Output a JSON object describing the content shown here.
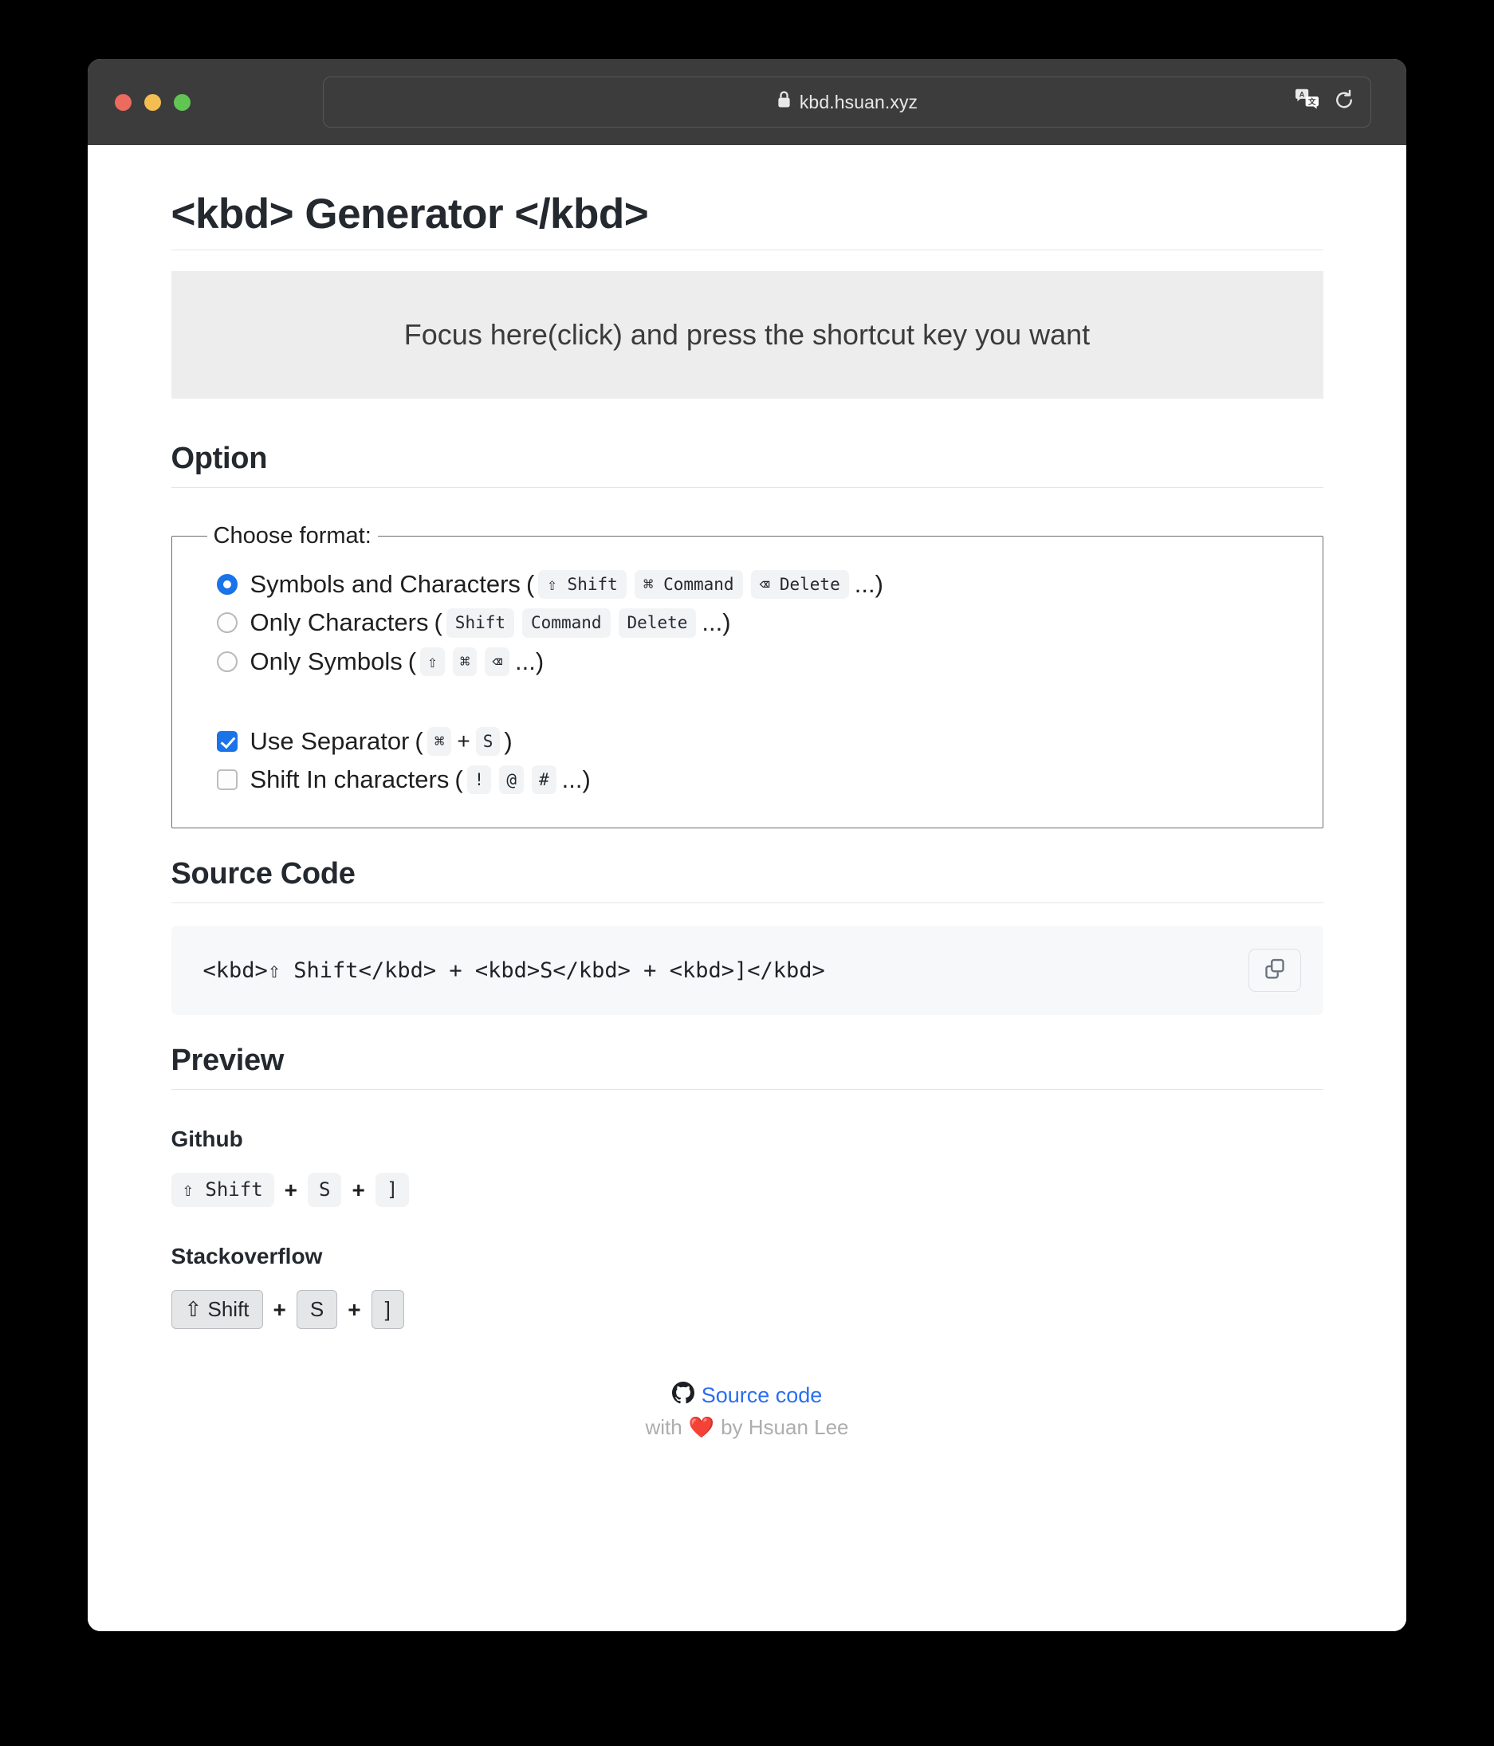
{
  "browser": {
    "url": "kbd.hsuan.xyz",
    "lock_icon": "lock-icon",
    "translate_icon": "translate-icon",
    "reload_icon": "reload-icon",
    "traffic_lights": [
      "close-red",
      "minimize-yellow",
      "maximize-green"
    ]
  },
  "page": {
    "title": "<kbd> Generator </kbd>",
    "focus_area_text": "Focus here(click) and press the shortcut key you want",
    "sections": {
      "option": "Option",
      "source_code": "Source Code",
      "preview": "Preview"
    }
  },
  "option": {
    "legend": "Choose format:",
    "radios": [
      {
        "label": "Symbols and Characters",
        "checked": true,
        "examples": [
          "⇧ Shift",
          "⌘ Command",
          "⌫ Delete"
        ],
        "ellipsis": "..."
      },
      {
        "label": "Only Characters",
        "checked": false,
        "examples": [
          "Shift",
          "Command",
          "Delete"
        ],
        "ellipsis": "..."
      },
      {
        "label": "Only Symbols",
        "checked": false,
        "examples": [
          "⇧",
          "⌘",
          "⌫"
        ],
        "ellipsis": "..."
      }
    ],
    "checkboxes": [
      {
        "label": "Use Separator",
        "checked": true,
        "examples": [
          "⌘",
          "S"
        ],
        "separator": "+",
        "ellipsis": ""
      },
      {
        "label": "Shift In characters",
        "checked": false,
        "examples": [
          "!",
          "@",
          "#"
        ],
        "ellipsis": "..."
      }
    ],
    "open_paren": "(",
    "close_paren": ")"
  },
  "source_code": {
    "code": "<kbd>⇧ Shift</kbd> + <kbd>S</kbd> + <kbd>]</kbd>",
    "copy_button_label": "copy-icon"
  },
  "preview": [
    {
      "title": "Github",
      "style": "github",
      "keys": [
        "⇧ Shift",
        "S",
        "]"
      ],
      "separator": "+"
    },
    {
      "title": "Stackoverflow",
      "style": "stackoverflow",
      "keys": [
        "⇧ Shift",
        "S",
        "]"
      ],
      "separator": "+"
    }
  ],
  "footer": {
    "link_text": "Source code",
    "github_icon": "github-icon",
    "credit_prefix": "with",
    "heart": "❤️",
    "credit_suffix": "by Hsuan Lee"
  },
  "colors": {
    "accent_blue": "#1a73e8",
    "link_blue": "#2a6ef0",
    "titlebar": "#3c3c3c",
    "focus_bg": "#ededed",
    "code_bg": "#f6f8fa",
    "kbd_bg": "#f1f3f5",
    "heading": "#24292f"
  }
}
